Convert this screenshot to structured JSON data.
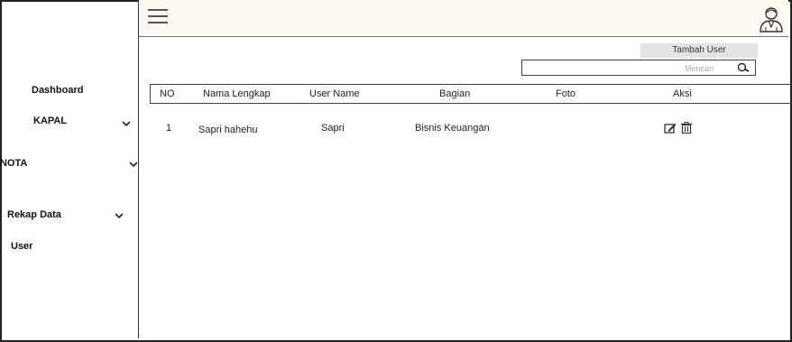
{
  "sidebar": {
    "items": [
      {
        "label": "Dashboard"
      },
      {
        "label": "KAPAL"
      },
      {
        "label": "NOTA"
      },
      {
        "label": "Rekap Data"
      },
      {
        "label": "User"
      }
    ]
  },
  "toolbar": {
    "add_user_label": "Tambah User",
    "search_placeholder": "Mencari"
  },
  "table": {
    "headers": [
      "NO",
      "Nama Lengkap",
      "User Name",
      "Bagian",
      "Foto",
      "Aksi"
    ],
    "rows": [
      {
        "no": "1",
        "nama": "Sapri hahehu",
        "username": "Sapri",
        "bagian": "Bisnis Keuangan",
        "foto": ""
      }
    ]
  },
  "icons": {
    "menu": "hamburger-icon",
    "profile": "user-avatar-icon",
    "search": "search-icon",
    "edit": "edit-icon",
    "delete": "trash-icon"
  }
}
